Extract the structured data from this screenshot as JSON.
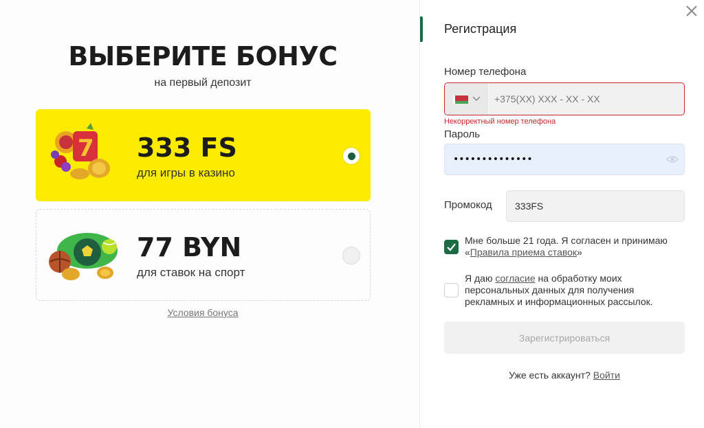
{
  "bonus": {
    "title": "ВЫБЕРИТЕ БОНУС",
    "subtitle": "на первый депозит",
    "options": [
      {
        "amount": "333 FS",
        "description": "для игры в казино",
        "selected": true
      },
      {
        "amount": "77 BYN",
        "description": "для ставок на спорт",
        "selected": false
      }
    ],
    "terms_link": "Условия бонуса"
  },
  "registration": {
    "title": "Регистрация",
    "phone": {
      "label": "Номер телефона",
      "placeholder": "+375(XX) XXX - XX - XX",
      "value": "",
      "country_flag": "belarus-flag-icon",
      "error": "Некорректный номер телефона"
    },
    "password": {
      "label": "Пароль",
      "value": "••••••••••••••"
    },
    "promo": {
      "label": "Промокод",
      "value": "333FS"
    },
    "age_consent": {
      "checked": true,
      "text_before": "Мне больше 21 года. Я согласен и принимаю «",
      "link": "Правила приема ставок",
      "text_after": "»"
    },
    "data_consent": {
      "checked": false,
      "text_before": "Я даю ",
      "link": "согласие",
      "text_after": " на обработку моих персональных данных для получения рекламных и информационных рассылок."
    },
    "submit_label": "Зарегистрироваться",
    "login_prompt": "Уже есть аккаунт?",
    "login_link": "Войти"
  },
  "colors": {
    "accent": "#1d6b45",
    "bonus_highlight": "#fbeb00",
    "error": "#c9262b"
  }
}
